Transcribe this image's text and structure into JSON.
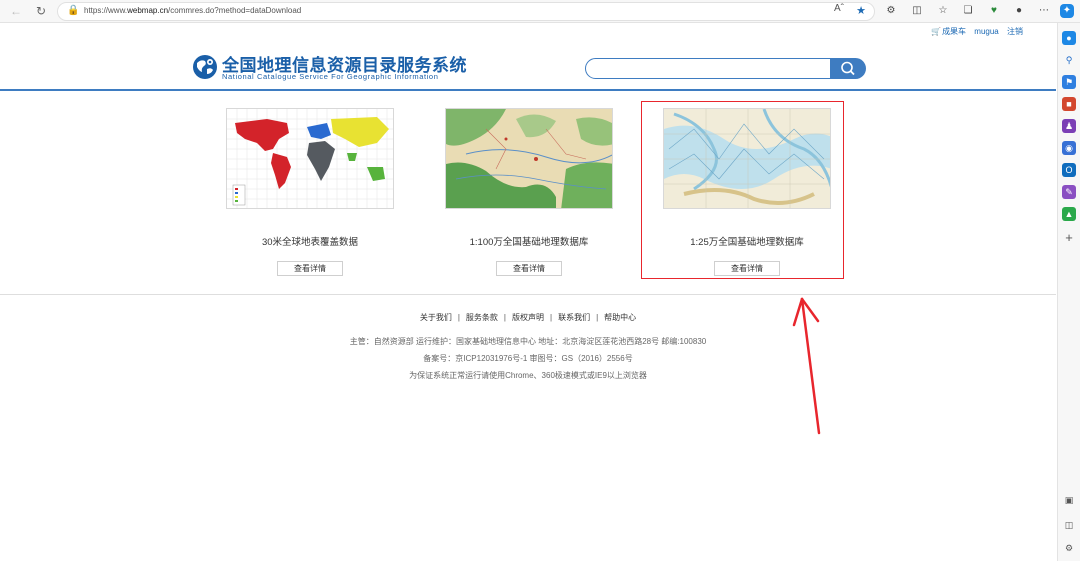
{
  "browser": {
    "url_prefix": "https://www.",
    "url_domain": "webmap.cn",
    "url_path": "/commres.do?method=dataDownload",
    "read_aloud_label": "Aˆ"
  },
  "user_bar": {
    "cart": "成果车",
    "username": "mugua",
    "logout": "注销"
  },
  "header": {
    "title_cn": "全国地理信息资源目录服务系统",
    "title_en": "National Catalogue Service For Geographic Information",
    "search_value": ""
  },
  "cards": [
    {
      "title": "30米全球地表覆盖数据",
      "button": "查看详情"
    },
    {
      "title": "1:100万全国基础地理数据库",
      "button": "查看详情"
    },
    {
      "title": "1:25万全国基础地理数据库",
      "button": "查看详情"
    }
  ],
  "footer": {
    "links": [
      "关于我们",
      "服务条款",
      "版权声明",
      "联系我们",
      "帮助中心"
    ],
    "separator": "|",
    "line1": "主管：自然资源部 运行维护：国家基础地理信息中心 地址：北京海淀区莲花池西路28号 邮编:100830",
    "line2": "备案号：京ICP12031976号-1 审图号：GS（2016）2556号",
    "line3": "为保证系统正常运行请使用Chrome、360极速模式或IE9以上浏览器"
  },
  "colors": {
    "brand_blue": "#1a5fa8",
    "accent_blue": "#3e7cc1",
    "highlight_red": "#e8262d"
  }
}
